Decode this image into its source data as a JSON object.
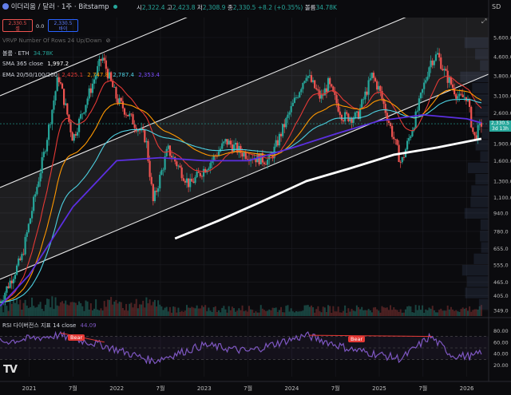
{
  "header": {
    "symbol": "이더리움 / 달러 · 1주 · Bitstamp",
    "ohlc": {
      "o_label": "시",
      "o": "2,322.4",
      "h_label": "고",
      "h": "2,423.8",
      "l_label": "저",
      "l": "2,308.9",
      "c_label": "종",
      "c": "2,330.5",
      "change": "+8.2 (+0.35%)",
      "vol_label": "볼륨",
      "vol": "34.78K"
    },
    "sell_price": "2,330.5",
    "sell_label": "셀",
    "spread": "0.0",
    "buy_price": "2,330.5",
    "buy_label": "바이",
    "currency_btn": "SD"
  },
  "indicators": {
    "vrvp": "VRVP Number Of Rows 24 Up/Down",
    "volume_label": "볼륨 · ETH",
    "volume_value": "34.78K",
    "sma_label": "SMA 365 close",
    "sma_value": "1,997.2",
    "ema_label": "EMA 20/50/100/200",
    "ema_values": [
      "2,425.1",
      "2,747.8",
      "2,787.4",
      "2,353.4"
    ],
    "rsi_label": "RSI 다이버전스 지표 14 close",
    "rsi_value": "44.09"
  },
  "colors": {
    "price_up": "#26a69a",
    "price_down": "#ef5350",
    "ema20": "#e53935",
    "ema50": "#ff9800",
    "ema100": "#4dd0e1",
    "ema200": "#5b2fe0",
    "sma365": "#ffffff",
    "rsi": "#7e57c2",
    "bear": "#e53935",
    "channel": "#ffffff",
    "background": "#0b0b0e"
  },
  "price_axis": [
    "5,600.0",
    "4,600.0",
    "3,800.0",
    "3,100.0",
    "2,600.0",
    "1,900.0",
    "1,600.0",
    "1,300.0",
    "1,100.0",
    "940.0",
    "780.0",
    "655.0",
    "555.0",
    "465.0",
    "405.0",
    "349.0"
  ],
  "rsi_axis": [
    "80.00",
    "60.00",
    "40.00",
    "20.00"
  ],
  "x_axis": [
    "2021",
    "7월",
    "2022",
    "7월",
    "2023",
    "7월",
    "2024",
    "7월",
    "2025",
    "7월",
    "2026"
  ],
  "price_badge": {
    "price": "2,330.5",
    "countdown": "3d 13h"
  },
  "bear_labels": [
    "Bear",
    "Bear"
  ],
  "chart_data": {
    "type": "line",
    "scale": "log",
    "xlim": [
      "2020-09",
      "2026-04"
    ],
    "ylim": [
      349,
      5600
    ],
    "series": [
      {
        "x": [
          "2020-09",
          "2020-12",
          "2021-03",
          "2021-05",
          "2021-07",
          "2021-11",
          "2022-01",
          "2022-05",
          "2022-06",
          "2022-08",
          "2022-11",
          "2023-02",
          "2023-04",
          "2023-06",
          "2023-08",
          "2023-10",
          "2023-12",
          "2024-03",
          "2024-05",
          "2024-06",
          "2024-08",
          "2024-10",
          "2024-12",
          "2025-01",
          "2025-03",
          "2025-04",
          "2025-06",
          "2025-08",
          "2025-09",
          "2025-10",
          "2025-12",
          "2026-01",
          "2026-02",
          "2026-03"
        ],
        "values": [
          380,
          600,
          1700,
          3800,
          2000,
          4600,
          3000,
          2000,
          1050,
          1800,
          1250,
          1600,
          1950,
          1750,
          1650,
          1600,
          2300,
          3900,
          3000,
          3500,
          2500,
          2500,
          3800,
          3300,
          2000,
          1550,
          2500,
          4400,
          4700,
          3900,
          3000,
          3100,
          2000,
          2330
        ]
      },
      {
        "name": "SMA 365 close",
        "x": [
          "2022-09",
          "2023-03",
          "2023-09",
          "2024-03",
          "2024-09",
          "2025-03",
          "2025-09",
          "2026-03"
        ],
        "values": [
          725,
          870,
          1060,
          1300,
          1480,
          1700,
          1830,
          2000
        ]
      },
      {
        "name": "EMA 200",
        "x": [
          "2020-09",
          "2021-01",
          "2021-07",
          "2022-01",
          "2022-07",
          "2023-01",
          "2023-07",
          "2024-01",
          "2024-07",
          "2025-01",
          "2025-07",
          "2026-01",
          "2026-03"
        ],
        "values": [
          365,
          500,
          1000,
          1600,
          1650,
          1600,
          1600,
          1820,
          2100,
          2400,
          2550,
          2450,
          2350
        ]
      }
    ],
    "rsi": {
      "x": [
        "2020-09",
        "2021-05",
        "2021-11",
        "2022-06",
        "2023-01",
        "2023-07",
        "2024-03",
        "2024-09",
        "2025-04",
        "2025-08",
        "2025-11",
        "2026-02",
        "2026-03"
      ],
      "values": [
        60,
        72,
        55,
        27,
        55,
        44,
        72,
        48,
        31,
        70,
        37,
        35,
        44
      ]
    }
  }
}
